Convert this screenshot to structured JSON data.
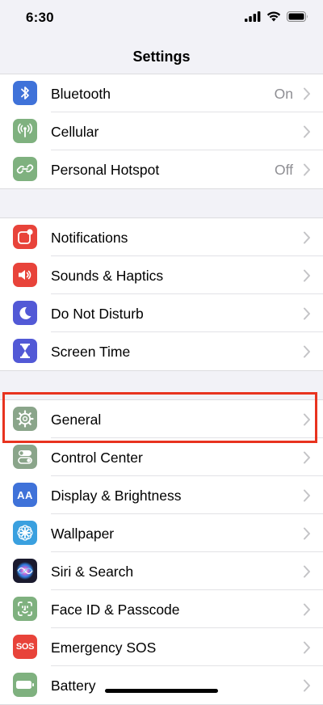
{
  "status_bar": {
    "time": "6:30"
  },
  "nav": {
    "title": "Settings"
  },
  "groups": [
    {
      "items": [
        {
          "label": "Bluetooth",
          "value": "On",
          "icon": "bluetooth-icon",
          "color": "#3f72d9"
        },
        {
          "label": "Cellular",
          "value": "",
          "icon": "antenna-icon",
          "color": "#7fb17f"
        },
        {
          "label": "Personal Hotspot",
          "value": "Off",
          "icon": "link-icon",
          "color": "#7fb17f"
        }
      ]
    },
    {
      "items": [
        {
          "label": "Notifications",
          "value": "",
          "icon": "notification-icon",
          "color": "#e8433a"
        },
        {
          "label": "Sounds & Haptics",
          "value": "",
          "icon": "speaker-icon",
          "color": "#e8433a"
        },
        {
          "label": "Do Not Disturb",
          "value": "",
          "icon": "moon-icon",
          "color": "#5259d6"
        },
        {
          "label": "Screen Time",
          "value": "",
          "icon": "hourglass-icon",
          "color": "#5259d6"
        }
      ]
    },
    {
      "items": [
        {
          "label": "General",
          "value": "",
          "icon": "gear-icon",
          "color": "#8aa58a"
        },
        {
          "label": "Control Center",
          "value": "",
          "icon": "toggles-icon",
          "color": "#8aa58a"
        },
        {
          "label": "Display & Brightness",
          "value": "",
          "icon": "text-size-icon",
          "color": "#3f72d9"
        },
        {
          "label": "Wallpaper",
          "value": "",
          "icon": "flower-icon",
          "color": "#3aa0df"
        },
        {
          "label": "Siri & Search",
          "value": "",
          "icon": "siri-icon",
          "color": "#1a1a2e"
        },
        {
          "label": "Face ID & Passcode",
          "value": "",
          "icon": "face-id-icon",
          "color": "#7fb17f"
        },
        {
          "label": "Emergency SOS",
          "value": "",
          "icon": "sos-icon",
          "color": "#e8433a"
        },
        {
          "label": "Battery",
          "value": "",
          "icon": "battery-icon",
          "color": "#7fb17f"
        }
      ]
    }
  ],
  "sos_text": "SOS",
  "display_icon_text": "AA",
  "colors": {
    "highlight": "#e8331f",
    "background": "#f2f2f7",
    "secondary_text": "#8e8e93"
  }
}
